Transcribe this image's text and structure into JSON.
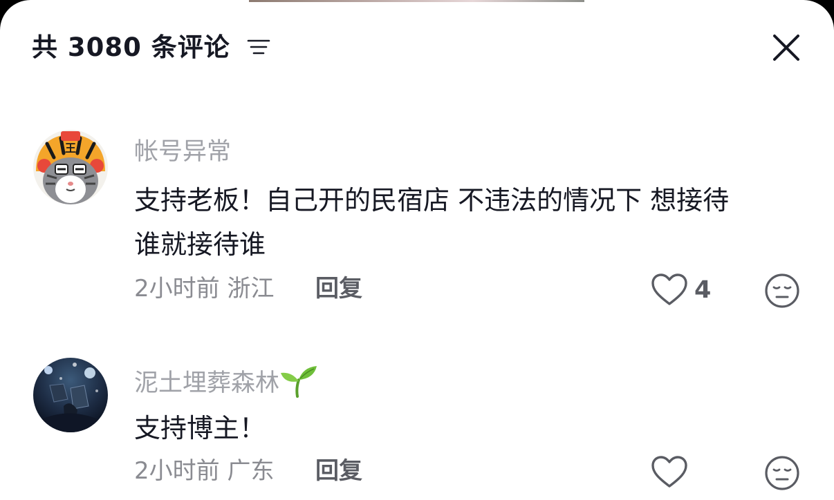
{
  "header": {
    "count_title": "共 3080 条评论",
    "sort_icon": "sort-lines-icon",
    "close_icon": "close-icon"
  },
  "comments": [
    {
      "username": "帐号异常",
      "avatar": "tiger-cat-avatar",
      "text_line1": "支持老板！自己开的民宿店 不违法的情况下 想接待",
      "text_line2": "谁就接待谁",
      "time": "2小时前",
      "location": "浙江",
      "reply_label": "回复",
      "like_count": "4"
    },
    {
      "username": "泥土埋葬森林",
      "username_emoji": "seedling-icon",
      "avatar": "night-scene-avatar",
      "text_line1": "支持博主！",
      "time": "2小时前",
      "location": "广东",
      "reply_label": "回复",
      "like_count": ""
    }
  ],
  "colors": {
    "primary_text": "#161823",
    "secondary_text": "#a0a2a8",
    "meta_text": "#8a8b91",
    "background": "#ffffff"
  }
}
